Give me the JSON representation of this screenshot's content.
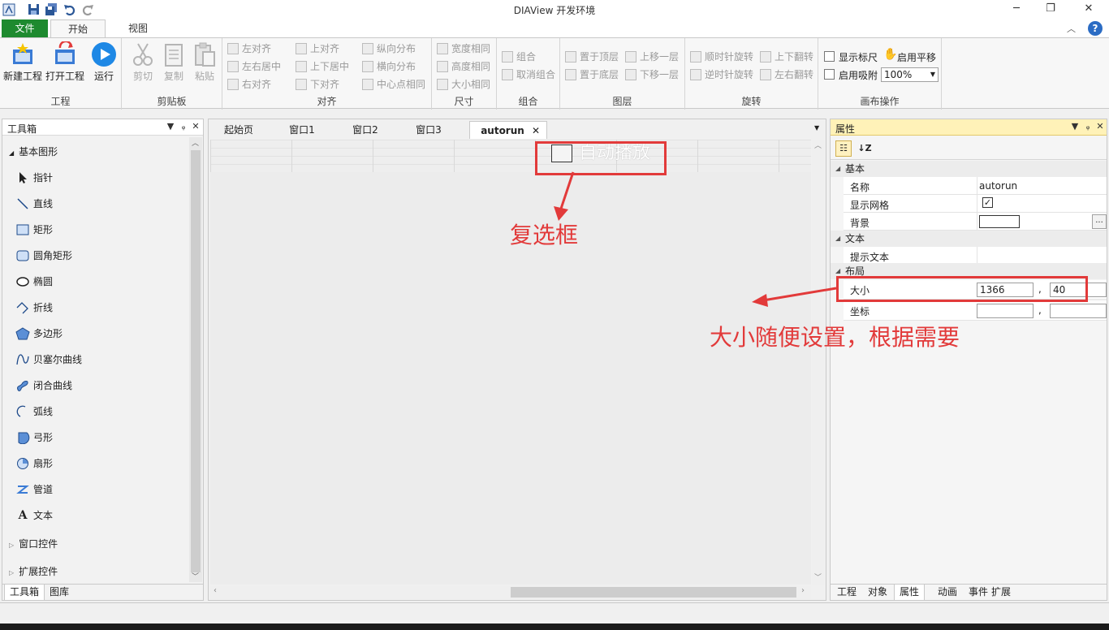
{
  "titlebar": {
    "title": "DIAView 开发环境",
    "quick_access": [
      "app-icon",
      "save-icon",
      "save-all-icon",
      "undo-icon",
      "redo-icon"
    ],
    "window_buttons": [
      "minimize-icon",
      "restore-icon",
      "close-icon"
    ]
  },
  "menu": {
    "file": "文件",
    "start": "开始",
    "view": "视图"
  },
  "ribbon": {
    "project": {
      "label": "工程",
      "new": "新建工程",
      "open": "打开工程",
      "run": "运行"
    },
    "clipboard": {
      "label": "剪贴板",
      "cut": "剪切",
      "copy": "复制",
      "paste": "粘贴"
    },
    "align": {
      "label": "对齐",
      "left": "左对齐",
      "center_h": "左右居中",
      "right": "右对齐",
      "top": "上对齐",
      "center_v": "上下居中",
      "bottom": "下对齐",
      "dist_v": "纵向分布",
      "dist_h": "横向分布",
      "center_point": "中心点相同"
    },
    "size": {
      "label": "尺寸",
      "width": "宽度相同",
      "height": "高度相同",
      "size": "大小相同"
    },
    "combine": {
      "label": "组合",
      "group": "组合",
      "ungroup": "取消组合"
    },
    "layer": {
      "label": "图层",
      "top": "置于顶层",
      "bottom": "置于底层",
      "up": "上移一层",
      "down": "下移一层"
    },
    "rotate": {
      "label": "旋转",
      "cw": "顺时针旋转",
      "ccw": "逆时针旋转",
      "flip_v": "上下翻转",
      "flip_h": "左右翻转"
    },
    "canvas": {
      "label": "画布操作",
      "ruler": "显示标尺",
      "pan": "启用平移",
      "snap": "启用吸附",
      "zoom": "100%"
    }
  },
  "toolbox": {
    "title": "工具箱",
    "category_basic": "基本图形",
    "tools": [
      "指针",
      "直线",
      "矩形",
      "圆角矩形",
      "椭圆",
      "折线",
      "多边形",
      "贝塞尔曲线",
      "闭合曲线",
      "弧线",
      "弓形",
      "扇形",
      "管道",
      "文本"
    ],
    "category_window": "窗口控件",
    "category_ext": "扩展控件",
    "bottom_tabs": [
      "工具箱",
      "图库"
    ]
  },
  "document": {
    "tabs": [
      "起始页",
      "窗口1",
      "窗口2",
      "窗口3",
      "autorun"
    ],
    "active_tab": "autorun",
    "checkbox_label": "自动播放"
  },
  "properties": {
    "title": "属性",
    "cat_basic": "基本",
    "name_label": "名称",
    "name_value": "autorun",
    "grid_label": "显示网格",
    "grid_check": "✓",
    "bg_label": "背景",
    "bg_btn": "...",
    "cat_text": "文本",
    "tooltip_label": "提示文本",
    "cat_layout": "布局",
    "size_label": "大小",
    "size_w": "1366",
    "size_h": "40",
    "pos_label": "坐标",
    "pos_x": "",
    "pos_y": "",
    "sep": ",",
    "bottom_tabs": [
      "工程",
      "对象",
      "属性",
      "动画",
      "事件",
      "扩展"
    ]
  },
  "annotations": {
    "checkbox_note": "复选框",
    "size_note": "大小随便设置，根据需要"
  },
  "colors": {
    "file_tab": "#1e8a2f",
    "annotation": "#e23a3a",
    "props_header": "#fff2b8"
  }
}
